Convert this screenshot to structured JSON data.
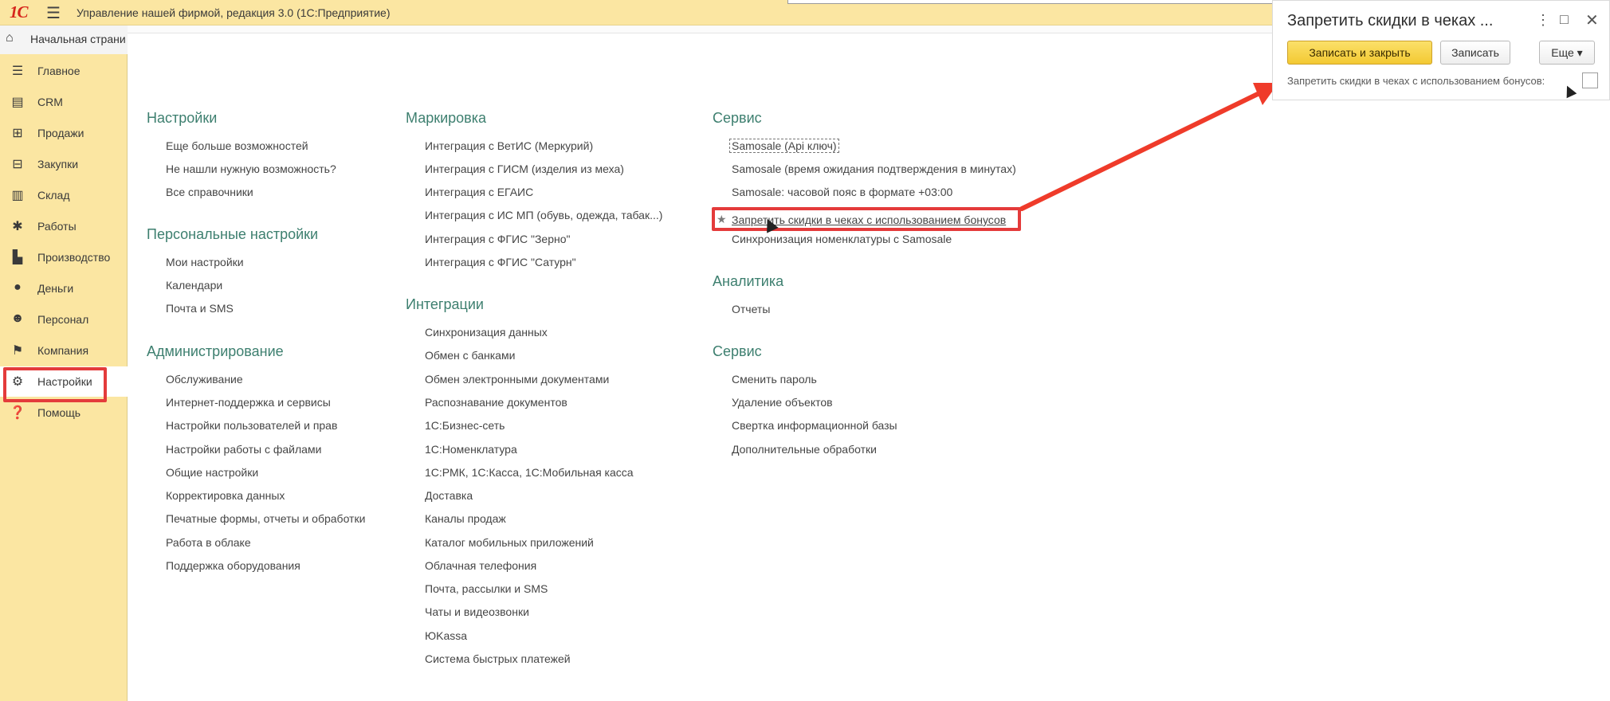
{
  "titlebar": {
    "logo": "1С",
    "menu_icon": "hamburger-icon",
    "title": "Управление нашей фирмой, редакция 3.0  (1С:Предприятие)"
  },
  "sidebar": {
    "home": {
      "icon": "home-icon",
      "label": "Начальная страни"
    },
    "items": [
      {
        "icon": "list-icon",
        "label": "Главное"
      },
      {
        "icon": "crm-icon",
        "label": "CRM"
      },
      {
        "icon": "cart-icon",
        "label": "Продажи"
      },
      {
        "icon": "purchase-icon",
        "label": "Закупки"
      },
      {
        "icon": "warehouse-icon",
        "label": "Склад"
      },
      {
        "icon": "tools-icon",
        "label": "Работы"
      },
      {
        "icon": "factory-icon",
        "label": "Производство"
      },
      {
        "icon": "money-icon",
        "label": "Деньги"
      },
      {
        "icon": "people-icon",
        "label": "Персонал"
      },
      {
        "icon": "flag-icon",
        "label": "Компания"
      },
      {
        "icon": "gear-icon",
        "label": "Настройки",
        "active": true
      },
      {
        "icon": "help-icon",
        "label": "Помощь"
      }
    ]
  },
  "columns": {
    "col1": {
      "sections": [
        {
          "title": "Настройки",
          "links": [
            "Еще больше возможностей",
            "Не нашли нужную возможность?",
            "Все справочники"
          ]
        },
        {
          "title": "Персональные настройки",
          "links": [
            "Мои настройки",
            "Календари",
            "Почта и SMS"
          ]
        },
        {
          "title": "Администрирование",
          "links": [
            "Обслуживание",
            "Интернет-поддержка и сервисы",
            "Настройки пользователей и прав",
            "Настройки работы с файлами",
            "Общие настройки",
            "Корректировка данных",
            "Печатные формы, отчеты и обработки",
            "Работа в облаке",
            "Поддержка оборудования"
          ]
        }
      ]
    },
    "col2": {
      "sections": [
        {
          "title": "Маркировка",
          "links": [
            "Интеграция с ВетИС (Меркурий)",
            "Интеграция с ГИСМ (изделия из меха)",
            "Интеграция с ЕГАИС",
            "Интеграция с ИС МП (обувь, одежда, табак...)",
            "Интеграция с ФГИС \"Зерно\"",
            "Интеграция с ФГИС \"Сатурн\""
          ]
        },
        {
          "title": "Интеграции",
          "links": [
            "Синхронизация данных",
            "Обмен с банками",
            "Обмен электронными документами",
            "Распознавание документов",
            "1С:Бизнес-сеть",
            "1С:Номенклатура",
            "1С:РМК, 1С:Касса, 1С:Мобильная касса",
            "Доставка",
            "Каналы продаж",
            "Каталог мобильных приложений",
            "Облачная телефония",
            "Почта, рассылки и SMS",
            "Чаты и видеозвонки",
            "ЮKassa",
            "Система быстрых платежей"
          ]
        }
      ]
    },
    "col3": {
      "sections": [
        {
          "title": "Сервис",
          "links": [
            "Samosale (Api ключ)",
            "Samosale (время ожидания подтверждения в минутах)",
            "Samosale: часовой пояс в формате +03:00",
            "Запретить скидки в чеках с использованием бонусов",
            "Синхронизация номенклатуры с Samosale"
          ]
        },
        {
          "title": "Аналитика",
          "links": [
            "Отчеты"
          ]
        },
        {
          "title": "Сервис",
          "links": [
            "Сменить пароль",
            "Удаление объектов",
            "Свертка информационной базы",
            "Дополнительные обработки"
          ]
        }
      ]
    }
  },
  "popup": {
    "title": "Запретить скидки в чеках ...",
    "more_icon": "⋮",
    "maximize_icon": "□",
    "close_icon": "✕",
    "save_close_label": "Записать и закрыть",
    "save_label": "Записать",
    "more_label": "Еще ▾",
    "field_label": "Запретить скидки в чеках с использованием бонусов:",
    "field_checked": false
  },
  "colors": {
    "accent_yellow": "#fbe6a2",
    "section_title": "#3d7f6f",
    "highlight_red": "#e43b3b"
  }
}
